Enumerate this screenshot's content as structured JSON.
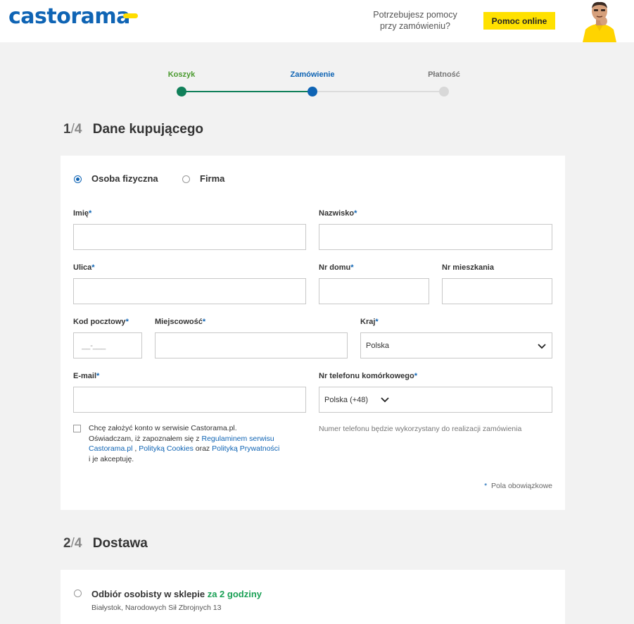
{
  "header": {
    "logo_text": "castorama",
    "help_text_line1": "Potrzebujesz pomocy",
    "help_text_line2": "przy zamówieniu?",
    "help_button": "Pomoc online"
  },
  "stepper": {
    "steps": [
      {
        "label": "Koszyk",
        "state": "done",
        "color": "#4a9a2e"
      },
      {
        "label": "Zamówienie",
        "state": "active",
        "color": "#0f64b4"
      },
      {
        "label": "Płatność",
        "state": "todo",
        "color": "#777777"
      }
    ]
  },
  "section1": {
    "num": "1",
    "slash": "/",
    "total": "4",
    "title": "Dane kupującego",
    "buyer_types": [
      {
        "label": "Osoba fizyczna",
        "selected": true
      },
      {
        "label": "Firma",
        "selected": false
      }
    ],
    "fields": {
      "first_name": "Imię",
      "last_name": "Nazwisko",
      "street": "Ulica",
      "house_no": "Nr domu",
      "apartment_no": "Nr mieszkania",
      "postal_code": "Kod pocztowy",
      "postal_placeholder": "__-___",
      "city": "Miejscowość",
      "country": "Kraj",
      "country_value": "Polska",
      "email": "E-mail",
      "phone": "Nr telefonu komórkowego",
      "phone_prefix": "Polska (+48)",
      "asterisk": "*"
    },
    "phone_hint": "Numer telefonu będzie wykorzystany do realizacji zamówienia",
    "consent": {
      "line1": "Chcę założyć konto w serwisie Castorama.pl.",
      "line2_pre": "Oświadczam, iż zapoznałem się z ",
      "link1": "Regulaminem serwisu Castorama.pl",
      "sep": " , ",
      "link2": "Polityką Cookies",
      "and": " oraz ",
      "link3": "Polityką Prywatności",
      "end": " i je akceptuję."
    },
    "required_note": "Pola obowiązkowe"
  },
  "section2": {
    "num": "2",
    "slash": "/",
    "total": "4",
    "title": "Dostawa",
    "option_label": "Odbiór osobisty w sklepie",
    "option_highlight": "za 2 godziny",
    "option_address": "Białystok, Narodowych Sił Zbrojnych 13"
  }
}
